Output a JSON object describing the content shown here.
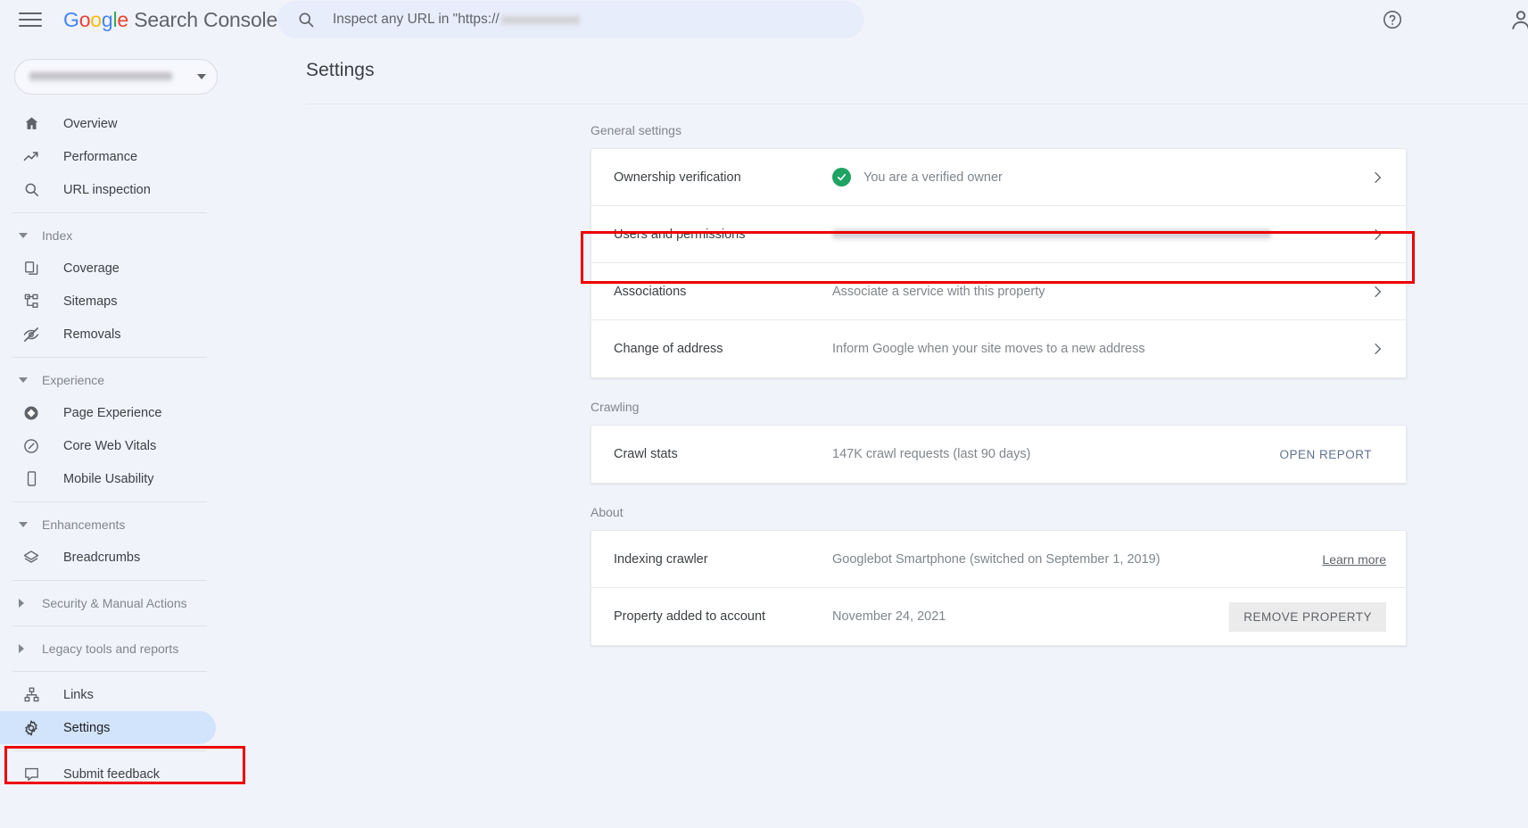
{
  "topbar": {
    "menu_icon": "hamburger-icon",
    "brand_g": "G",
    "brand_o1": "o",
    "brand_o2": "o",
    "brand_g2": "g",
    "brand_l": "l",
    "brand_e": "e",
    "brand_rest": " Search Console",
    "search_placeholder_prefix": "Inspect any URL in \"https://",
    "search_icon": "search-icon",
    "help_icon": "help-circle-icon",
    "avatar": "account-avatar"
  },
  "sidebar": {
    "property_selector": {
      "name": "property-selector",
      "caret": "chevron-down-icon"
    },
    "items": [
      {
        "label": "Overview",
        "icon": "home-icon",
        "type": "item"
      },
      {
        "label": "Performance",
        "icon": "trending-up-icon",
        "type": "item"
      },
      {
        "label": "URL inspection",
        "icon": "search-icon",
        "type": "item"
      },
      {
        "label": "Index",
        "icon": "chevron-down-icon",
        "type": "section",
        "expanded": true
      },
      {
        "label": "Coverage",
        "icon": "copy-pages-icon",
        "type": "item"
      },
      {
        "label": "Sitemaps",
        "icon": "sitemap-icon",
        "type": "item"
      },
      {
        "label": "Removals",
        "icon": "eye-off-icon",
        "type": "item"
      },
      {
        "label": "Experience",
        "icon": "chevron-down-icon",
        "type": "section",
        "expanded": true
      },
      {
        "label": "Page Experience",
        "icon": "diamond-circle-icon",
        "type": "item"
      },
      {
        "label": "Core Web Vitals",
        "icon": "speedometer-icon",
        "type": "item"
      },
      {
        "label": "Mobile Usability",
        "icon": "mobile-phone-icon",
        "type": "item"
      },
      {
        "label": "Enhancements",
        "icon": "chevron-down-icon",
        "type": "section",
        "expanded": true
      },
      {
        "label": "Breadcrumbs",
        "icon": "layers-icon",
        "type": "item"
      },
      {
        "label": "Security & Manual Actions",
        "icon": "chevron-right-icon",
        "type": "section",
        "expanded": false
      },
      {
        "label": "Legacy tools and reports",
        "icon": "chevron-right-icon",
        "type": "section",
        "expanded": false
      },
      {
        "label": "Links",
        "icon": "links-tree-icon",
        "type": "item"
      },
      {
        "label": "Settings",
        "icon": "gear-icon",
        "type": "item",
        "active": true
      },
      {
        "label": "Submit feedback",
        "icon": "feedback-icon",
        "type": "item"
      }
    ]
  },
  "main": {
    "page_title": "Settings",
    "sections": [
      {
        "label": "General settings",
        "rows": [
          {
            "label": "Ownership verification",
            "value": "You are a verified owner",
            "badge": "verified-check-icon",
            "chevron": "chevron-right-icon"
          },
          {
            "label": "Users and permissions",
            "value": "",
            "redacted": true,
            "chevron": "chevron-right-icon"
          },
          {
            "label": "Associations",
            "value": "Associate a service with this property",
            "chevron": "chevron-right-icon"
          },
          {
            "label": "Change of address",
            "value": "Inform Google when your site moves to a new address",
            "chevron": "chevron-right-icon"
          }
        ]
      },
      {
        "label": "Crawling",
        "rows": [
          {
            "label": "Crawl stats",
            "value": "147K crawl requests (last 90 days)",
            "action": "OPEN REPORT"
          }
        ]
      },
      {
        "label": "About",
        "rows": [
          {
            "label": "Indexing crawler",
            "value": "Googlebot Smartphone (switched on September 1, 2019)",
            "link": "Learn more"
          },
          {
            "label": "Property added to account",
            "value": "November 24, 2021",
            "action_filled": "REMOVE PROPERTY"
          }
        ]
      }
    ]
  },
  "annotations": {
    "highlight_color": "#ee0000",
    "boxes": [
      "users-and-permissions-row",
      "sidebar-item-settings"
    ]
  }
}
